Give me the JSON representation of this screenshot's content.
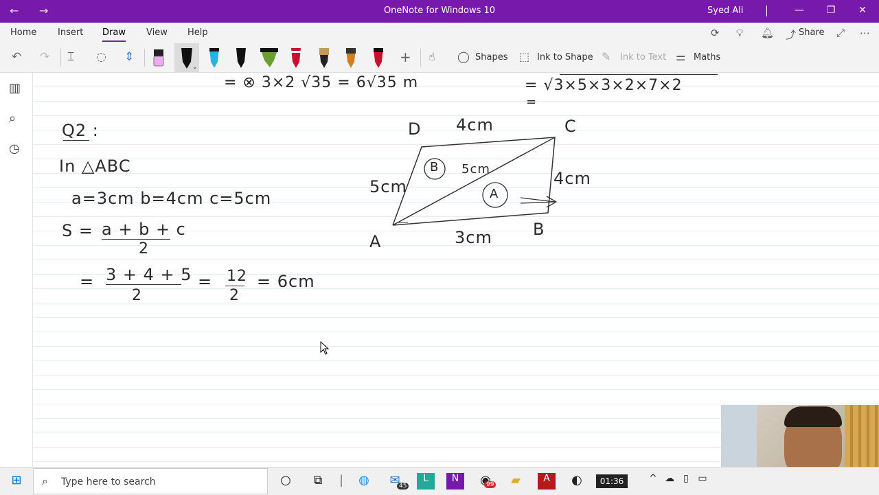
{
  "titlebar": {
    "back_icon": "←",
    "forward_icon": "→",
    "title": "OneNote for Windows 10",
    "user": "Syed Ali",
    "minimize_icon": "—",
    "restore_icon": "❐",
    "close_icon": "✕"
  },
  "ribbon": {
    "tabs": [
      "Home",
      "Insert",
      "Draw",
      "View",
      "Help"
    ],
    "active_tab": "Draw",
    "share_label": "Share"
  },
  "toolbar": {
    "shapes_label": "Shapes",
    "ink_to_shape_label": "Ink to Shape",
    "ink_to_text_label": "Ink to Text",
    "maths_label": "Maths",
    "pen_colors": [
      "#f2a8f2",
      "#111111",
      "#2ab0e8",
      "#111111",
      "#6aa030",
      "#c8102e",
      "#222222",
      "#d08020",
      "#c8102e"
    ]
  },
  "page": {
    "top_left_line": "= ⊗ 3×2 √35 = 6√35 m",
    "top_right_line": "= √3×5×3×2×7×2",
    "top_right_line2": "=",
    "q_label": "Q2 :",
    "in_triangle": "In △ABC",
    "sides": "a=3cm  b=4cm   c=5cm",
    "s_formula_lhs": "S =",
    "s_formula_num": "a + b + c",
    "s_formula_den": "2",
    "eq_line_num1": "3 + 4 + 5",
    "eq_line_den1": "2",
    "eq_line_num2": "12",
    "eq_line_den2": "2",
    "eq_result": "= 6cm",
    "figure": {
      "D": "D",
      "C": "C",
      "A": "A",
      "B": "B",
      "top": "4cm",
      "right": "4cm",
      "left": "5cm",
      "bottom": "3cm",
      "diagonal": "5cm",
      "region_b": "B",
      "region_a": "A"
    }
  },
  "taskbar": {
    "search_placeholder": "Type here to search",
    "mail_badge": "45",
    "whatsapp_badge": "99",
    "clock": "01:36"
  }
}
